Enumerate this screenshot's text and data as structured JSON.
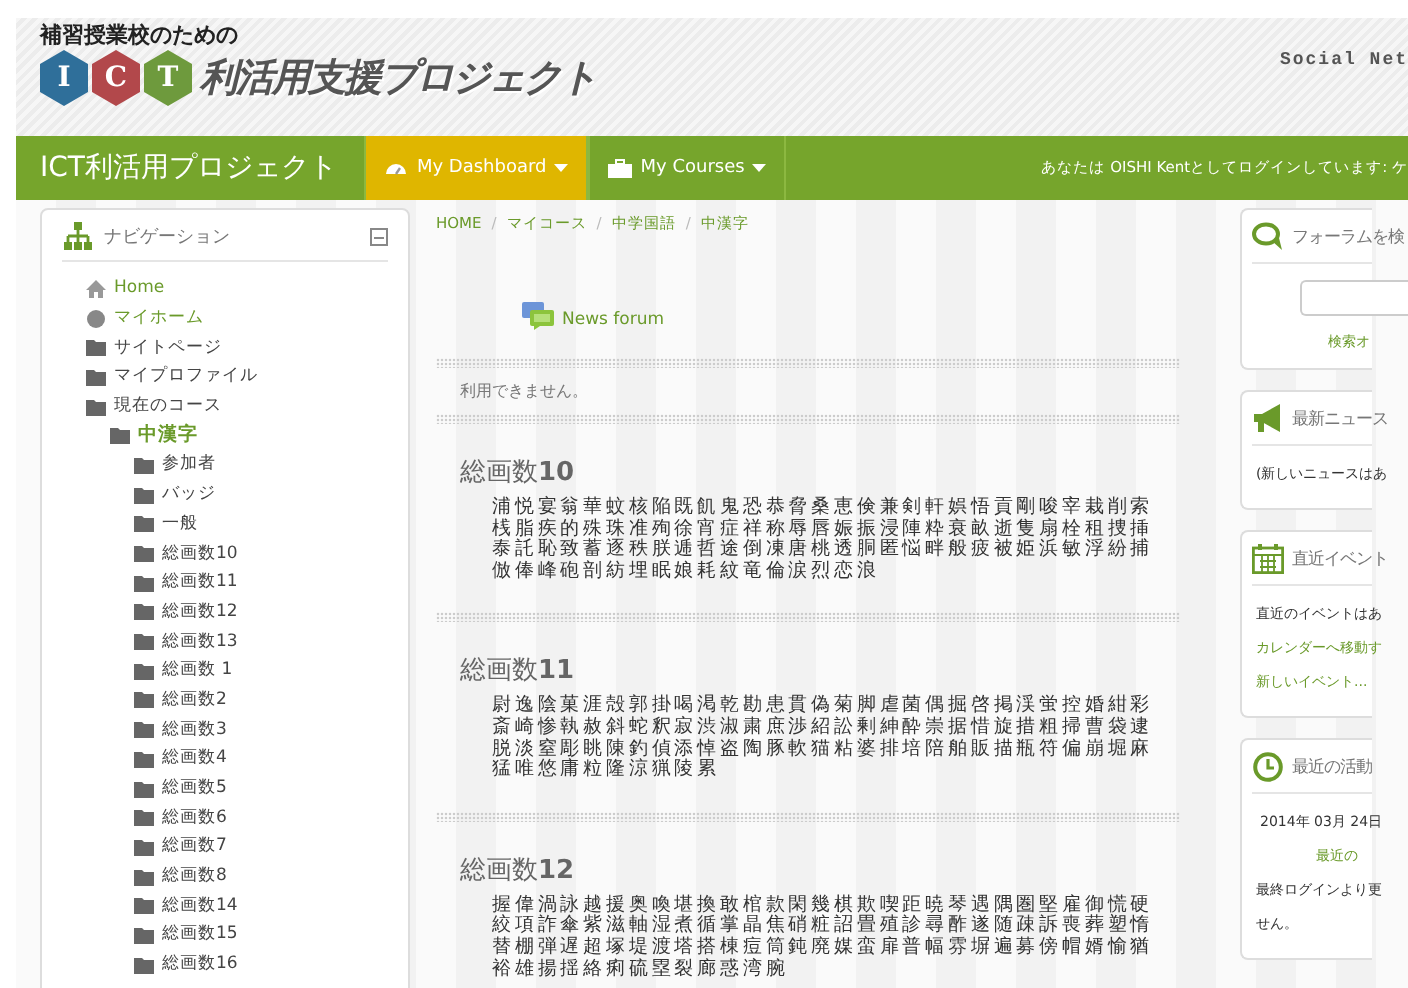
{
  "header": {
    "tagline": "補習授業校のための",
    "badges": [
      {
        "letter": "I",
        "color": "#2f6f9a"
      },
      {
        "letter": "C",
        "color": "#b2484b"
      },
      {
        "letter": "T",
        "color": "#6e9a3d"
      }
    ],
    "title": "利活用支援プロジェクト",
    "social": "Social Net"
  },
  "navbar": {
    "brand": "ICT利活用プロジェクト",
    "menus": [
      {
        "label": "My Dashboard",
        "selected": true
      },
      {
        "label": "My Courses",
        "selected": false
      }
    ],
    "login": "あなたは OISHI Kentとしてログインしています: ケ"
  },
  "navigation": {
    "title": "ナビゲーション",
    "items": [
      {
        "label": "Home",
        "kind": "home",
        "link": true,
        "selected": false
      },
      {
        "label": "マイホーム",
        "kind": "circle",
        "link": true,
        "selected": false
      },
      {
        "label": "サイトページ",
        "kind": "folder",
        "link": false,
        "selected": false
      },
      {
        "label": "マイプロファイル",
        "kind": "folder",
        "link": false,
        "selected": false
      },
      {
        "label": "現在のコース",
        "kind": "folder",
        "link": false,
        "selected": false,
        "children": [
          {
            "label": "中漢字",
            "kind": "folder",
            "link": true,
            "selected": true,
            "children": [
              {
                "label": "参加者",
                "kind": "folder",
                "link": false,
                "selected": false
              },
              {
                "label": "バッジ",
                "kind": "folder",
                "link": false,
                "selected": false
              },
              {
                "label": "一般",
                "kind": "folder",
                "link": false,
                "selected": false
              },
              {
                "label": "総画数10",
                "kind": "folder",
                "link": false,
                "selected": false
              },
              {
                "label": "総画数11",
                "kind": "folder",
                "link": false,
                "selected": false
              },
              {
                "label": "総画数12",
                "kind": "folder",
                "link": false,
                "selected": false
              },
              {
                "label": "総画数13",
                "kind": "folder",
                "link": false,
                "selected": false
              },
              {
                "label": "総画数 1",
                "kind": "folder",
                "link": false,
                "selected": false
              },
              {
                "label": "総画数2",
                "kind": "folder",
                "link": false,
                "selected": false
              },
              {
                "label": "総画数3",
                "kind": "folder",
                "link": false,
                "selected": false
              },
              {
                "label": "総画数4",
                "kind": "folder",
                "link": false,
                "selected": false
              },
              {
                "label": "総画数5",
                "kind": "folder",
                "link": false,
                "selected": false
              },
              {
                "label": "総画数6",
                "kind": "folder",
                "link": false,
                "selected": false
              },
              {
                "label": "総画数7",
                "kind": "folder",
                "link": false,
                "selected": false
              },
              {
                "label": "総画数8",
                "kind": "folder",
                "link": false,
                "selected": false
              },
              {
                "label": "総画数14",
                "kind": "folder",
                "link": false,
                "selected": false
              },
              {
                "label": "総画数15",
                "kind": "folder",
                "link": false,
                "selected": false
              },
              {
                "label": "総画数16",
                "kind": "folder",
                "link": false,
                "selected": false
              }
            ]
          }
        ]
      }
    ]
  },
  "breadcrumb": {
    "separator": "/",
    "items": [
      "HOME",
      "マイコース",
      "中学国語",
      "中漢字"
    ]
  },
  "forum_link": "News forum",
  "notice": "利用できません。",
  "sections": [
    {
      "title": "総画数**10**",
      "kanji": "浦悦宴翁華蚊核陥既飢鬼恐恭脅桑恵倹兼剣軒娯悟貢剛唆宰栽削索桟脂疾的殊珠准殉徐宵症祥称辱唇娠振浸陣粋衰畝逝隻扇栓租捜挿泰託恥致蓄逐秩朕逓哲途倒凍唐桃透胴匿悩畔般疲被姫浜敏浮紛捕倣俸峰砲剖紡埋眠娘耗紋竜倫涙烈恋浪"
    },
    {
      "title": "総画数**11**",
      "kanji": "尉逸陰菓涯殻郭掛喝渇乾勘患貫偽菊脚虐菌偶掘啓掲渓蛍控婚紺彩斎崎惨執赦斜蛇釈寂渋淑粛庶渉紹訟剰紳酔崇据惜旋措粗掃曹袋逮脱淡窒彫眺陳釣偵添悼盗陶豚軟猫粘婆排培陪舶販描瓶符偏崩堀麻猛唯悠庸粒隆涼猟陵累"
    },
    {
      "title": "総画数**12**",
      "kanji": "握偉渦詠越援奥喚堪換敢棺款閑幾棋欺喫距暁琴遇隅圏堅雇御慌硬絞項詐傘紫滋軸湿煮循掌晶焦硝粧詔畳殖診尋酢遂随疎訴喪葬塑惰替棚弾遅超塚堤渡塔搭棟痘筒鈍廃媒蛮扉普幅雰塀遍募傍帽婿愉猶裕雄揚揺絡痢硫塁裂廊惑湾腕"
    }
  ],
  "blocks": [
    {
      "kind": "search",
      "title": "フォーラムを検",
      "link": "検索オ"
    },
    {
      "kind": "list",
      "title": "最新ニュース",
      "lines": [
        {
          "text": "(新しいニュースはあ",
          "link": false,
          "center": false
        }
      ]
    },
    {
      "kind": "list",
      "title": "直近イベント",
      "lines": [
        {
          "text": "直近のイベントはあ",
          "link": false,
          "center": false
        },
        {
          "text": "カレンダーへ移動す",
          "link": true,
          "center": false
        },
        {
          "text": "新しいイベント...",
          "link": true,
          "center": false
        }
      ]
    },
    {
      "kind": "list",
      "title": "最近の活動",
      "lines": [
        {
          "text": "2014年 03月 24日",
          "link": false,
          "center": true
        },
        {
          "text": "最近の",
          "link": true,
          "center": true
        },
        {
          "text": "最終ログインより更",
          "link": false,
          "center": false
        },
        {
          "text": "せん。",
          "link": false,
          "center": false
        }
      ]
    }
  ]
}
